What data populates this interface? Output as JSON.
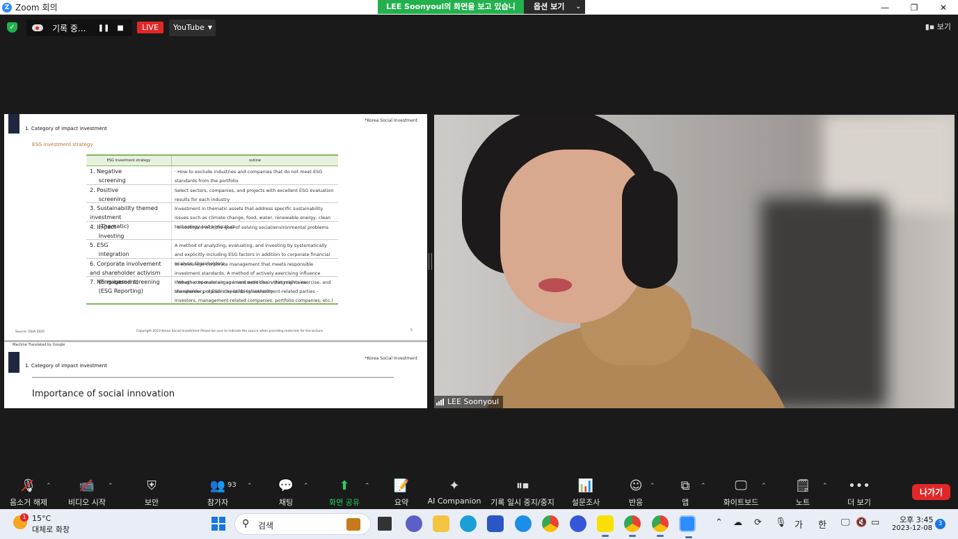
{
  "window": {
    "title": "Zoom 회의",
    "app_icon_letter": "Z",
    "controls": [
      "—",
      "❐",
      "✕"
    ]
  },
  "share_banner": {
    "text": "LEE Soonyoul의 화면을 보고 있습니다",
    "options_label": "옵션 보기"
  },
  "topbar": {
    "recording_label": "기록 중...",
    "live_label": "LIVE",
    "stream_target": "YouTube",
    "view_label": "보기"
  },
  "slide": {
    "header": "1. Category of impact investment",
    "corp": "*Korea Social Investment",
    "subtitle": "ESG investment strategy",
    "table_headers": [
      "ESG investment strategy",
      "outline"
    ],
    "rows": [
      {
        "strategy": "1. Negative\n     screening",
        "outline": "·  How to exclude industries and companies that do not meet ESG standards from the portfolio"
      },
      {
        "strategy": "2. Positive\n     screening",
        "outline": "Select sectors, companies, and projects with excellent ESG evaluation results for each industry"
      },
      {
        "strategy": "3. Sustainability themed investment\n     (Thematic)",
        "outline": "Investment in thematic assets that address specific sustainability issues such as climate change, food, water, renewable energy, clean technology and agriculture"
      },
      {
        "strategy": "4. Impact\n     Investing",
        "outline": "·  Investment with the goal of solving social/environmental problems"
      },
      {
        "strategy": "5. ESG\n     integration",
        "outline": "A method of analyzing, evaluating, and investing by systematically and explicitly including ESG factors in addition to corporate financial analysis Shareholders"
      },
      {
        "strategy": "6. Corporate involvement and shareholder activism\n     (Engagement)",
        "outline": "to encourage corporate management that meets responsible investment standards. A method of actively exercising influence through corporate engagement activities, voting rights exercise, and shareholder proposals by utilizing authority"
      },
      {
        "strategy": "7. Norm-based screening\n     (ESG Reporting)",
        "outline": "·  Whether to maintain an investment chain that maintains transparency of ESG standards (all investment-related parties - investors, management-related companies, portfolio companies, etc.)"
      }
    ],
    "source": "Source: GSIA 2020",
    "copyright": "Copyright 2023 Korea Social Investment Please be sure to indicate the source when providing materials for the lecture.",
    "page": "5",
    "watermark": "Machine Translated by Google",
    "next_header": "1. Category of impact investment",
    "next_corp": "*Korea Social Investment",
    "next_title": "Importance of social innovation"
  },
  "video": {
    "participant_name": "LEE Soonyoul"
  },
  "toolbar": {
    "mute": "음소거 해제",
    "video": "비디오 시작",
    "security": "보안",
    "participants": "참가자",
    "participants_count": "93",
    "chat": "채팅",
    "share": "화면 공유",
    "summary": "요약",
    "ai": "AI Companion",
    "record": "기록 일시 중지/중지",
    "poll": "설문조사",
    "react": "반응",
    "apps": "앱",
    "whiteboard": "화이트보드",
    "notes": "노트",
    "more": "더 보기",
    "leave": "나가기"
  },
  "taskbar": {
    "weather_temp": "15°C",
    "weather_desc": "대체로 화창",
    "weather_badge": "1",
    "search_label": "검색",
    "ime_1": "가",
    "ime_2": "한",
    "time": "오후 3:45",
    "date": "2023-12-08",
    "notification_count": "3"
  }
}
